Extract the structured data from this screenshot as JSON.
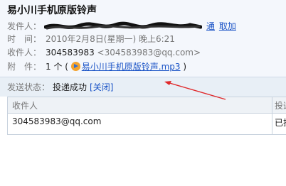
{
  "subject": "易小川手机原版铃声",
  "sender": {
    "label": "发件人：",
    "links": [
      "通",
      "取加"
    ]
  },
  "time": {
    "label": "时　间：",
    "value": "2010年2月8日(星期一) 晚上6:21"
  },
  "recipient": {
    "label": "收件人：",
    "name": "304583983",
    "email": "<304583983@qq.com>"
  },
  "attachment": {
    "label": "附　件：",
    "count": "1 个 (",
    "file": "易小川手机原版铃声.mp3",
    "close": ")"
  },
  "status": {
    "label": "发送状态：",
    "value": "投递成功",
    "close_link": "[关闭]"
  },
  "table": {
    "headers": [
      "收件人",
      "投递"
    ],
    "rows": [
      {
        "recipient": "304583983@qq.com",
        "status": "已投"
      }
    ]
  },
  "colors": {
    "link": "#1a53c6",
    "arrow": "#e0282a",
    "header_bg": "#f4f7fc",
    "status_bg": "#e8eff6"
  }
}
